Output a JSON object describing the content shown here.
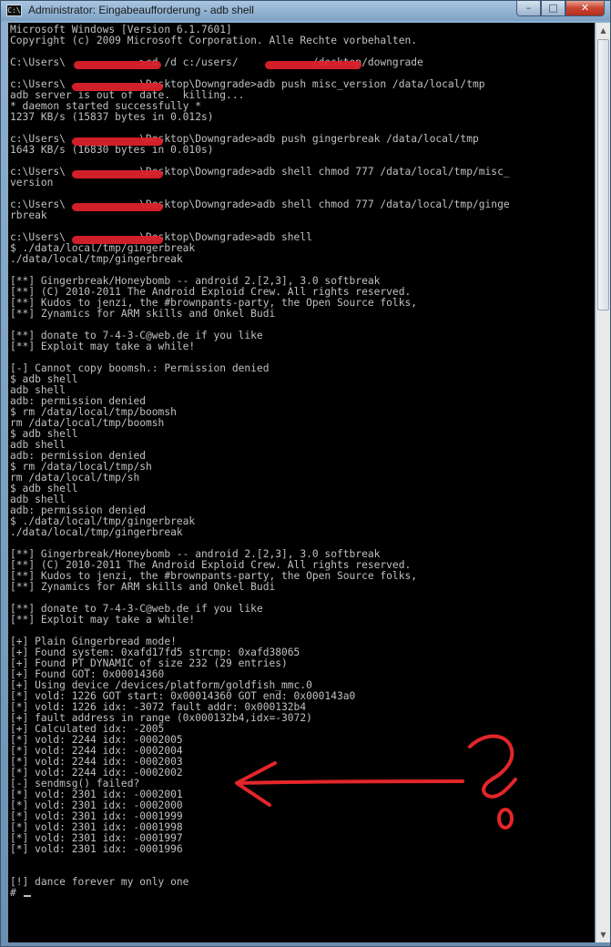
{
  "window": {
    "title": "Administrator: Eingabeaufforderung - adb  shell",
    "icon_text": "C:\\",
    "icon": "cmd-icon"
  },
  "controls": {
    "minimize": "–",
    "maximize": "□",
    "close": "✕"
  },
  "console": {
    "text": "Microsoft Windows [Version 6.1.7601]\nCopyright (c) 2009 Microsoft Corporation. Alle Rechte vorbehalten.\n\nC:\\Users\\            >cd /d c:/users/            /desktop/downgrade\n\nc:\\Users\\            \\Desktop\\Downgrade>adb push misc_version /data/local/tmp\nadb server is out of date.  killing...\n* daemon started successfully *\n1237 KB/s (15837 bytes in 0.012s)\n\nc:\\Users\\            \\Desktop\\Downgrade>adb push gingerbreak /data/local/tmp\n1643 KB/s (16830 bytes in 0.010s)\n\nc:\\Users\\            \\Desktop\\Downgrade>adb shell chmod 777 /data/local/tmp/misc_\nversion\n\nc:\\Users\\            \\Desktop\\Downgrade>adb shell chmod 777 /data/local/tmp/ginge\nrbreak\n\nc:\\Users\\            \\Desktop\\Downgrade>adb shell\n$ ./data/local/tmp/gingerbreak\n./data/local/tmp/gingerbreak\n\n[**] Gingerbreak/Honeybomb -- android 2.[2,3], 3.0 softbreak\n[**] (C) 2010-2011 The Android Exploid Crew. All rights reserved.\n[**] Kudos to jenzi, the #brownpants-party, the Open Source folks,\n[**] Zynamics for ARM skills and Onkel Budi\n\n[**] donate to 7-4-3-C@web.de if you like\n[**] Exploit may take a while!\n\n[-] Cannot copy boomsh.: Permission denied\n$ adb shell\nadb shell\nadb: permission denied\n$ rm /data/local/tmp/boomsh\nrm /data/local/tmp/boomsh\n$ adb shell\nadb shell\nadb: permission denied\n$ rm /data/local/tmp/sh\nrm /data/local/tmp/sh\n$ adb shell\nadb shell\nadb: permission denied\n$ ./data/local/tmp/gingerbreak\n./data/local/tmp/gingerbreak\n\n[**] Gingerbreak/Honeybomb -- android 2.[2,3], 3.0 softbreak\n[**] (C) 2010-2011 The Android Exploid Crew. All rights reserved.\n[**] Kudos to jenzi, the #brownpants-party, the Open Source folks,\n[**] Zynamics for ARM skills and Onkel Budi\n\n[**] donate to 7-4-3-C@web.de if you like\n[**] Exploit may take a while!\n\n[+] Plain Gingerbread mode!\n[+] Found system: 0xafd17fd5 strcmp: 0xafd38065\n[+] Found PT_DYNAMIC of size 232 (29 entries)\n[+] Found GOT: 0x00014360\n[+] Using device /devices/platform/goldfish_mmc.0\n[*] vold: 1226 GOT start: 0x00014360 GOT end: 0x000143a0\n[*] vold: 1226 idx: -3072 fault addr: 0x000132b4\n[+] fault address in range (0x000132b4,idx=-3072)\n[+] Calculated idx: -2005\n[*] vold: 2244 idx: -0002005\n[*] vold: 2244 idx: -0002004\n[*] vold: 2244 idx: -0002003\n[*] vold: 2244 idx: -0002002\n[-] sendmsg() failed?\n[*] vold: 2301 idx: -0002001\n[*] vold: 2301 idx: -0002000\n[*] vold: 2301 idx: -0001999\n[*] vold: 2301 idx: -0001998\n[*] vold: 2301 idx: -0001997\n[*] vold: 2301 idx: -0001996\n\n\n[!] dance forever my only one\n# ",
    "background": "#000000",
    "foreground": "#c0c0c0"
  },
  "scrollbar": {
    "up": "▲",
    "down": "▼"
  },
  "annotation": {
    "color": "#e3262a",
    "shapes": [
      "red-arrow",
      "question-mark"
    ],
    "redaction_color": "#e0212b"
  }
}
